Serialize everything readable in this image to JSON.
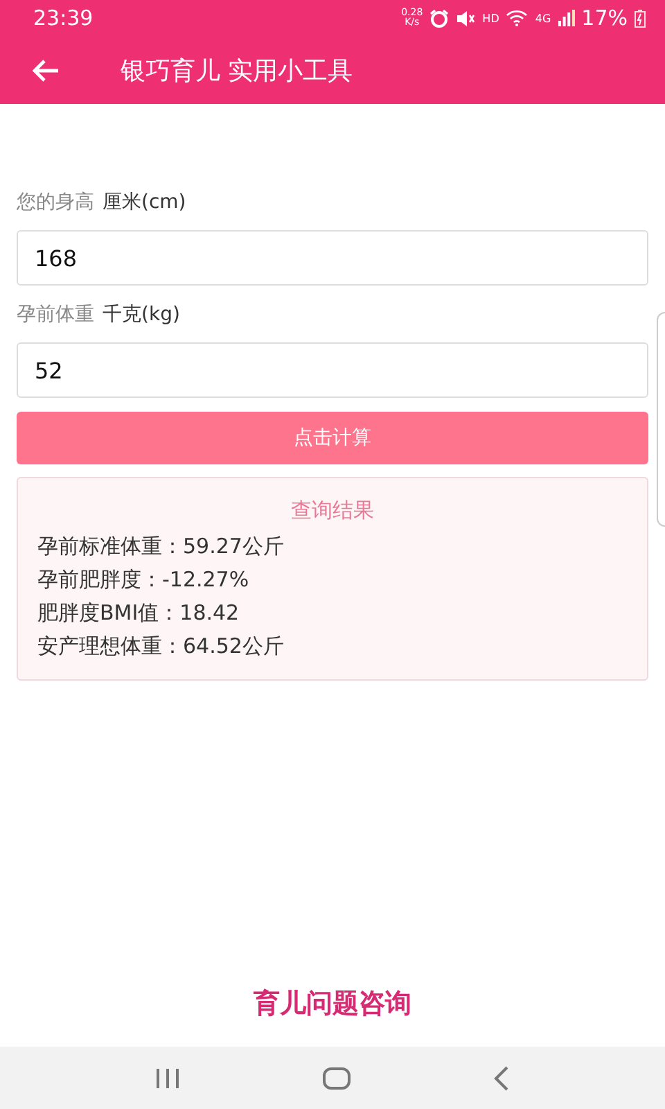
{
  "status_bar": {
    "time": "23:39",
    "net_speed": "0.28",
    "net_unit": "K/s",
    "hd": "HD",
    "network": "4G",
    "battery": "17%"
  },
  "app_bar": {
    "title": "银巧育儿 实用小工具"
  },
  "form": {
    "fields": [
      {
        "label": "您的身高",
        "unit": "厘米(cm)",
        "value": "168"
      },
      {
        "label": "孕前体重",
        "unit": "千克(kg)",
        "value": "52"
      }
    ],
    "button": "点击计算"
  },
  "result": {
    "title": "查询结果",
    "lines": [
      "孕前标准体重：59.27公斤",
      "孕前肥胖度：-12.27%",
      "肥胖度BMI值：18.42",
      "安产理想体重：64.52公斤"
    ]
  },
  "footer_link": "育儿问题咨询"
}
